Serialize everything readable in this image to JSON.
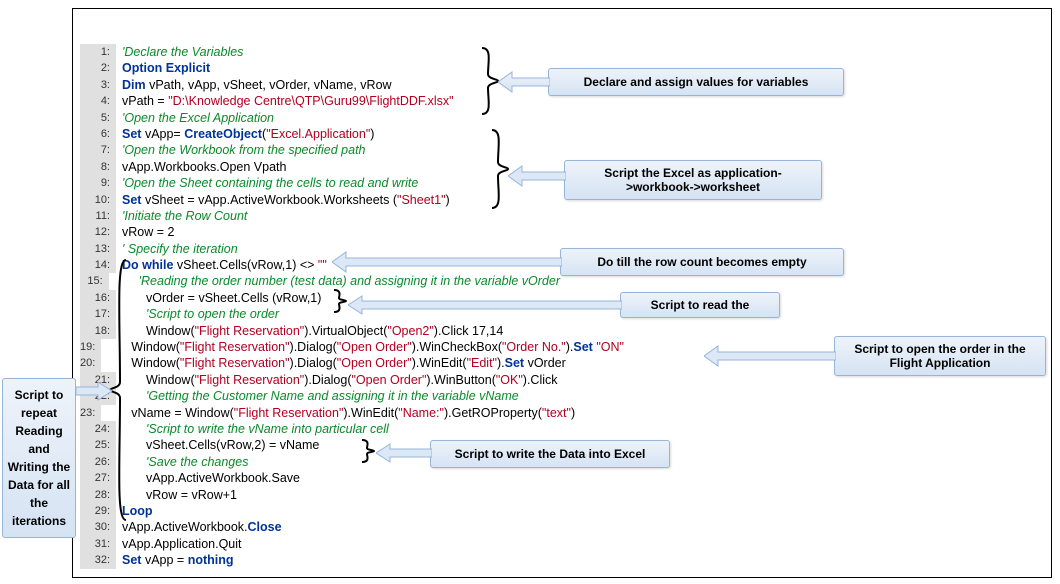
{
  "lines": [
    {
      "n": "1:",
      "ind": 0,
      "parts": [
        {
          "c": "cm",
          "t": "'Declare the Variables"
        }
      ]
    },
    {
      "n": "2:",
      "ind": 0,
      "parts": [
        {
          "c": "kw",
          "t": "Option Explicit"
        }
      ]
    },
    {
      "n": "3:",
      "ind": 0,
      "parts": [
        {
          "c": "kw",
          "t": "Dim "
        },
        {
          "c": "tx",
          "t": "vPath, vApp, vSheet, vOrder, vName, vRow"
        }
      ]
    },
    {
      "n": "4:",
      "ind": 0,
      "parts": [
        {
          "c": "tx",
          "t": "vPath = "
        },
        {
          "c": "st",
          "t": "\"D:\\Knowledge Centre\\QTP\\Guru99\\FlightDDF.xlsx\""
        }
      ]
    },
    {
      "n": "5:",
      "ind": 0,
      "parts": [
        {
          "c": "cm",
          "t": "'Open the Excel Application"
        }
      ]
    },
    {
      "n": "6:",
      "ind": 0,
      "parts": [
        {
          "c": "kw",
          "t": "Set "
        },
        {
          "c": "tx",
          "t": "vApp= "
        },
        {
          "c": "kw",
          "t": "CreateObject"
        },
        {
          "c": "tx",
          "t": "("
        },
        {
          "c": "st",
          "t": "\"Excel.Application\""
        },
        {
          "c": "tx",
          "t": ")"
        }
      ]
    },
    {
      "n": "7:",
      "ind": 0,
      "parts": [
        {
          "c": "cm",
          "t": "'Open the Workbook from the specified path"
        }
      ]
    },
    {
      "n": "8:",
      "ind": 0,
      "parts": [
        {
          "c": "tx",
          "t": "vApp.Workbooks.Open Vpath"
        }
      ]
    },
    {
      "n": "9:",
      "ind": 0,
      "parts": [
        {
          "c": "cm",
          "t": "'Open the Sheet containing the cells to read and write"
        }
      ]
    },
    {
      "n": "10:",
      "ind": 0,
      "parts": [
        {
          "c": "kw",
          "t": "Set "
        },
        {
          "c": "tx",
          "t": "vSheet = vApp.ActiveWorkbook.Worksheets ("
        },
        {
          "c": "st",
          "t": "\"Sheet1\""
        },
        {
          "c": "tx",
          "t": ")"
        }
      ]
    },
    {
      "n": "11:",
      "ind": 0,
      "parts": [
        {
          "c": "cm",
          "t": "'Initiate the Row Count"
        }
      ]
    },
    {
      "n": "12:",
      "ind": 0,
      "parts": [
        {
          "c": "tx",
          "t": "vRow = 2"
        }
      ]
    },
    {
      "n": "13:",
      "ind": 0,
      "parts": [
        {
          "c": "cm",
          "t": "' Specify the iteration"
        }
      ]
    },
    {
      "n": "14:",
      "ind": 0,
      "parts": [
        {
          "c": "kw",
          "t": "Do while "
        },
        {
          "c": "tx",
          "t": "vSheet.Cells(vRow,1) <> "
        },
        {
          "c": "st",
          "t": "\"\""
        }
      ]
    },
    {
      "n": "15:",
      "ind": 1,
      "parts": [
        {
          "c": "cm",
          "t": "'Reading the order number (test data) and assigning it in the variable vOrder"
        }
      ]
    },
    {
      "n": "16:",
      "ind": 1,
      "parts": [
        {
          "c": "tx",
          "t": "vOrder = vSheet.Cells (vRow,1)"
        }
      ]
    },
    {
      "n": "17:",
      "ind": 1,
      "parts": [
        {
          "c": "cm",
          "t": "'Script to open the order"
        }
      ]
    },
    {
      "n": "18:",
      "ind": 1,
      "parts": [
        {
          "c": "tx",
          "t": "Window("
        },
        {
          "c": "st",
          "t": "\"Flight Reservation\""
        },
        {
          "c": "tx",
          "t": ").VirtualObject("
        },
        {
          "c": "st",
          "t": "\"Open2\""
        },
        {
          "c": "tx",
          "t": ").Click 17,14"
        }
      ]
    },
    {
      "n": "19:",
      "ind": 1,
      "parts": [
        {
          "c": "tx",
          "t": "Window("
        },
        {
          "c": "st",
          "t": "\"Flight Reservation\""
        },
        {
          "c": "tx",
          "t": ").Dialog("
        },
        {
          "c": "st",
          "t": "\"Open Order\""
        },
        {
          "c": "tx",
          "t": ").WinCheckBox("
        },
        {
          "c": "st",
          "t": "\"Order No.\""
        },
        {
          "c": "tx",
          "t": ")."
        },
        {
          "c": "kw",
          "t": "Set "
        },
        {
          "c": "st",
          "t": "\"ON\""
        }
      ]
    },
    {
      "n": "20:",
      "ind": 1,
      "parts": [
        {
          "c": "tx",
          "t": "Window("
        },
        {
          "c": "st",
          "t": "\"Flight Reservation\""
        },
        {
          "c": "tx",
          "t": ").Dialog("
        },
        {
          "c": "st",
          "t": "\"Open Order\""
        },
        {
          "c": "tx",
          "t": ").WinEdit("
        },
        {
          "c": "st",
          "t": "\"Edit\""
        },
        {
          "c": "tx",
          "t": ")."
        },
        {
          "c": "kw",
          "t": "Set "
        },
        {
          "c": "tx",
          "t": "vOrder"
        }
      ]
    },
    {
      "n": "21:",
      "ind": 1,
      "parts": [
        {
          "c": "tx",
          "t": "Window("
        },
        {
          "c": "st",
          "t": "\"Flight Reservation\""
        },
        {
          "c": "tx",
          "t": ").Dialog("
        },
        {
          "c": "st",
          "t": "\"Open Order\""
        },
        {
          "c": "tx",
          "t": ").WinButton("
        },
        {
          "c": "st",
          "t": "\"OK\""
        },
        {
          "c": "tx",
          "t": ").Click"
        }
      ]
    },
    {
      "n": "22:",
      "ind": 1,
      "parts": [
        {
          "c": "cm",
          "t": "'Getting the Customer Name and assigning it in the variable vName"
        }
      ]
    },
    {
      "n": "23:",
      "ind": 1,
      "parts": [
        {
          "c": "tx",
          "t": "vName = Window("
        },
        {
          "c": "st",
          "t": "\"Flight Reservation\""
        },
        {
          "c": "tx",
          "t": ").WinEdit("
        },
        {
          "c": "st",
          "t": "\"Name:\""
        },
        {
          "c": "tx",
          "t": ").GetROProperty("
        },
        {
          "c": "st",
          "t": "\"text\""
        },
        {
          "c": "tx",
          "t": ")"
        }
      ]
    },
    {
      "n": "24:",
      "ind": 1,
      "parts": [
        {
          "c": "cm",
          "t": "'Script to write the vName into particular cell"
        }
      ]
    },
    {
      "n": "25:",
      "ind": 1,
      "parts": [
        {
          "c": "tx",
          "t": "vSheet.Cells(vRow,2) = vName"
        }
      ]
    },
    {
      "n": "26:",
      "ind": 1,
      "parts": [
        {
          "c": "cm",
          "t": "'Save the changes"
        }
      ]
    },
    {
      "n": "27:",
      "ind": 1,
      "parts": [
        {
          "c": "tx",
          "t": "vApp.ActiveWorkbook.Save"
        }
      ]
    },
    {
      "n": "28:",
      "ind": 1,
      "parts": [
        {
          "c": "tx",
          "t": "vRow = vRow+1"
        }
      ]
    },
    {
      "n": "29:",
      "ind": 0,
      "parts": [
        {
          "c": "kw",
          "t": "Loop"
        }
      ]
    },
    {
      "n": "30:",
      "ind": 0,
      "parts": [
        {
          "c": "tx",
          "t": "vApp.ActiveWorkbook."
        },
        {
          "c": "kw",
          "t": "Close"
        }
      ]
    },
    {
      "n": "31:",
      "ind": 0,
      "parts": [
        {
          "c": "tx",
          "t": "vApp.Application.Quit"
        }
      ]
    },
    {
      "n": "32:",
      "ind": 0,
      "parts": [
        {
          "c": "kw",
          "t": "Set "
        },
        {
          "c": "tx",
          "t": "vApp = "
        },
        {
          "c": "kw",
          "t": "nothing"
        }
      ]
    }
  ],
  "callouts": {
    "c1": "Declare and assign values for variables",
    "c2": "Script the Excel as application->workbook->worksheet",
    "c3": "Do till the row count becomes empty",
    "c4": "Script to read the",
    "c5": "Script to open the order in the Flight Application",
    "c6": "Script to write the Data into Excel",
    "c7": "Script to repeat Reading and Writing the Data for all the iterations"
  }
}
